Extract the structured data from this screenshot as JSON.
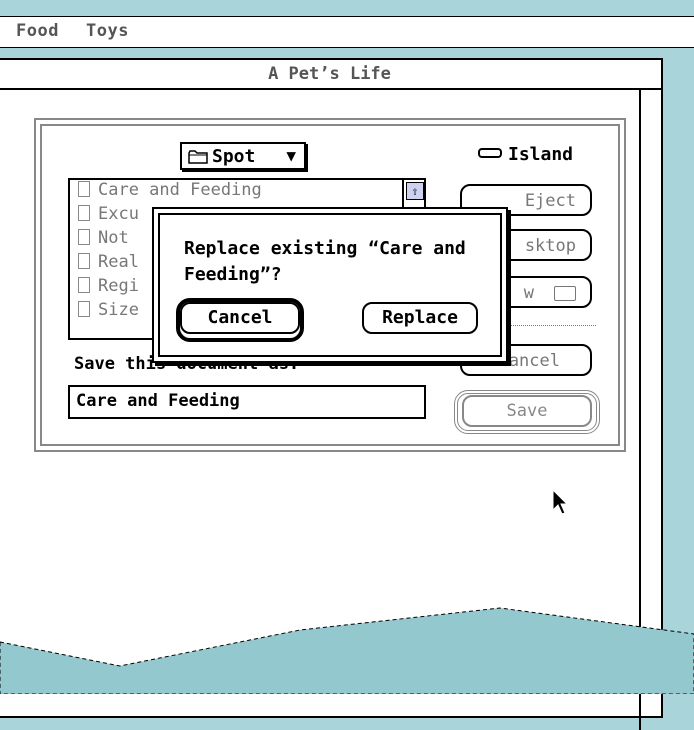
{
  "menubar": {
    "items": [
      "Food",
      "Toys"
    ]
  },
  "window": {
    "title": "A Pet’s Life"
  },
  "save_dialog": {
    "folder": "Spot",
    "disk": "Island",
    "files": [
      "Care and Feeding",
      "Excu",
      "Not",
      "Real",
      "Regi",
      "Size"
    ],
    "buttons": {
      "eject": "Eject",
      "desktop": "sktop",
      "new": "w",
      "cancel": "ancel",
      "save": "Save"
    },
    "save_as_label": "Save this document as:",
    "filename": "Care and Feeding"
  },
  "alert": {
    "message": "Replace existing “Care and Feeding”?",
    "cancel": "Cancel",
    "replace": "Replace"
  },
  "colors": {
    "background": "#a9d4da",
    "dimmed_text": "#777777"
  }
}
